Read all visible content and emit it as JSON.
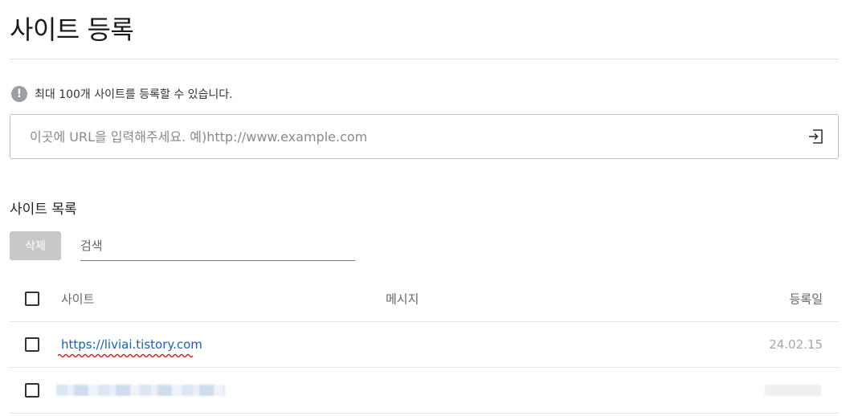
{
  "page": {
    "title": "사이트 등록"
  },
  "notice": {
    "icon": "info-icon",
    "icon_glyph": "!",
    "text": "최대 100개 사이트를 등록할 수 있습니다."
  },
  "url_input": {
    "value": "",
    "placeholder": "이곳에 URL을 입력해주세요. 예)http://www.example.com",
    "submit_icon": "enter-icon"
  },
  "site_list": {
    "title": "사이트 목록",
    "delete_label": "삭제",
    "search_placeholder": "검색",
    "columns": {
      "site": "사이트",
      "message": "메시지",
      "date": "등록일"
    },
    "rows": [
      {
        "site": "https://liviai.tistory.com",
        "message": "",
        "date": "24.02.15"
      },
      {
        "site": "",
        "message": "",
        "date": ""
      }
    ]
  },
  "colors": {
    "link": "#1c5fb3",
    "button_disabled": "#c8c8c8",
    "spell_underline": "#e02020"
  }
}
